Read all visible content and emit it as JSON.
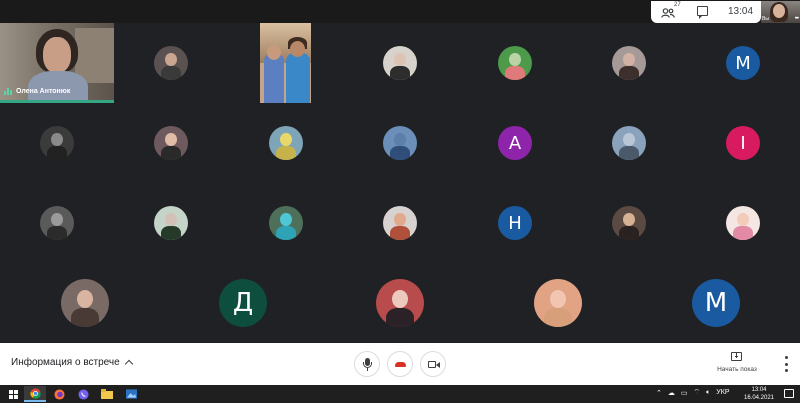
{
  "topbar": {
    "participants_count": "27",
    "time": "13:04",
    "participants_icon": "people-icon",
    "chat_icon": "chat-icon"
  },
  "self_view": {
    "label": "Вы",
    "more_icon": "more-dots-icon"
  },
  "main_video": {
    "name": "Олена Антонюк",
    "speaking_icon": "audio-level-icon",
    "accent": "#35a683"
  },
  "participants": [
    {
      "kind": "photo",
      "head": "#caa690",
      "body": "#3a3a3a",
      "bg": "#5a5250"
    },
    {
      "kind": "photo",
      "head": "#dcc3b2",
      "body": "#2d2d2d",
      "bg": "#d8d2cc"
    },
    {
      "kind": "photo",
      "head": "#b9d3a6",
      "body": "#e07a7a",
      "bg": "#4c9a4a"
    },
    {
      "kind": "photo",
      "head": "#d2b2a4",
      "body": "#3d2f2c",
      "bg": "#a59a97"
    },
    {
      "kind": "letter",
      "letter": "M",
      "color": "#1a5aa0"
    },
    {
      "kind": "photo",
      "head": "#8a8a8a",
      "body": "#222222",
      "bg": "#3b3b3b"
    },
    {
      "kind": "photo",
      "head": "#e0bca6",
      "body": "#2a2a2a",
      "bg": "#6e5a5e"
    },
    {
      "kind": "photo",
      "head": "#e8d86a",
      "body": "#c6b24a",
      "bg": "#7ea4b8"
    },
    {
      "kind": "photo",
      "head": "#5a7fa8",
      "body": "#2f4e7a",
      "bg": "#6b8fb8"
    },
    {
      "kind": "letter",
      "letter": "A",
      "color": "#8e24aa"
    },
    {
      "kind": "photo",
      "head": "#b8c6d6",
      "body": "#4a5a6a",
      "bg": "#8aa2bc"
    },
    {
      "kind": "letter",
      "letter": "I",
      "color": "#d81b60"
    },
    {
      "kind": "photo",
      "head": "#9a9a9a",
      "body": "#2b2b2b",
      "bg": "#5a5a5a"
    },
    {
      "kind": "photo",
      "head": "#d3c1b8",
      "body": "#263a2a",
      "bg": "#c4d4c8"
    },
    {
      "kind": "photo",
      "head": "#4ec6d6",
      "body": "#2ea3b6",
      "bg": "#4e6f5a"
    },
    {
      "kind": "photo",
      "head": "#e2a98c",
      "body": "#b0503a",
      "bg": "#d7d2cf"
    },
    {
      "kind": "letter",
      "letter": "H",
      "color": "#1a5aa0"
    },
    {
      "kind": "photo",
      "head": "#d5b294",
      "body": "#2a2220",
      "bg": "#5a4a42"
    },
    {
      "kind": "photo",
      "head": "#f2cbb9",
      "body": "#e28aa6",
      "bg": "#f4e6e2"
    },
    {
      "kind": "photo",
      "head": "#d9b5a1",
      "body": "#4a3a36",
      "bg": "#7a6a66"
    },
    {
      "kind": "letter",
      "letter": "Д",
      "color": "#0e4e3f"
    },
    {
      "kind": "photo",
      "head": "#ecc9bd",
      "body": "#2a2226",
      "bg": "#b84b4b"
    },
    {
      "kind": "photo",
      "head": "#f0c6b2",
      "body": "#d7a07a",
      "bg": "#e1a383"
    },
    {
      "kind": "letter",
      "letter": "M",
      "color": "#1a5aa0"
    }
  ],
  "controls": {
    "meeting_info": "Информация о встрече",
    "mic_icon": "mic-icon",
    "hangup_icon": "hangup-icon",
    "camera_icon": "camera-icon",
    "present_label": "Начать показ",
    "present_icon": "present-screen-icon",
    "more_icon": "more-vert-icon"
  },
  "taskbar": {
    "lang": "УКР",
    "time": "13:04",
    "date": "16.04.2021",
    "apps": [
      "start-icon",
      "chrome-icon",
      "firefox-icon",
      "viber-icon",
      "explorer-icon",
      "photos-icon"
    ]
  }
}
